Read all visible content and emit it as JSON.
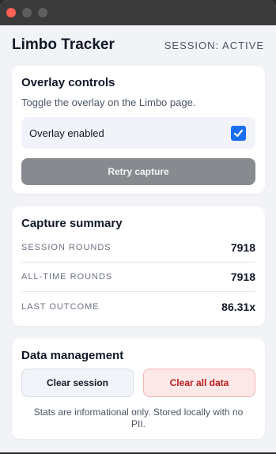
{
  "header": {
    "title": "Limbo Tracker",
    "status": "SESSION: ACTIVE"
  },
  "overlay": {
    "title": "Overlay controls",
    "description": "Toggle the overlay on the Limbo page.",
    "toggle_label": "Overlay enabled",
    "toggle_checked": true,
    "retry_label": "Retry capture"
  },
  "summary": {
    "title": "Capture summary",
    "stats": [
      {
        "label": "SESSION ROUNDS",
        "value": "7918"
      },
      {
        "label": "ALL-TIME ROUNDS",
        "value": "7918"
      },
      {
        "label": "LAST OUTCOME",
        "value": "86.31x"
      }
    ]
  },
  "data_management": {
    "title": "Data management",
    "clear_session_label": "Clear session",
    "clear_all_label": "Clear all data",
    "footnote": "Stats are informational only. Stored locally with no PII."
  },
  "colors": {
    "accent": "#1a6ff2",
    "danger": "#b91c1c"
  }
}
